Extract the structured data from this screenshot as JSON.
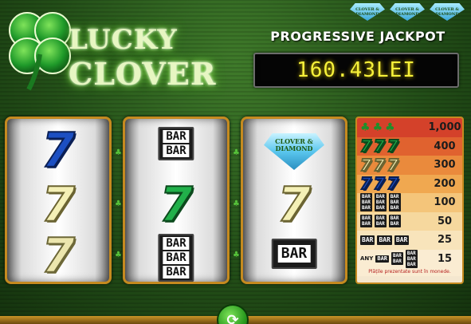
{
  "logo": {
    "line1": "LUCKY",
    "line2": "CLOVER",
    "icon": "four-leaf-clover-icon"
  },
  "top_badges": [
    {
      "text": "CLOVER & DIAMOND"
    },
    {
      "text": "CLOVER & DIAMOND"
    },
    {
      "text": "CLOVER & DIAMOND"
    }
  ],
  "jackpot": {
    "title": "PROGRESSIVE JACKPOT",
    "value": "160.43LEI"
  },
  "reels": [
    {
      "symbols": [
        "7",
        "7",
        "7"
      ],
      "colors": [
        "blue",
        "yellow",
        "pale"
      ]
    },
    {
      "symbols": [
        "BAR BAR",
        "7",
        "BAR BAR BAR"
      ],
      "colors": [
        "",
        "green",
        ""
      ]
    },
    {
      "symbols": [
        "CLOVER & DIAMOND",
        "7",
        "BAR"
      ],
      "colors": [
        "",
        "yellow",
        ""
      ]
    }
  ],
  "paytable": {
    "rows": [
      {
        "icons": "clover x3",
        "value": "1,000"
      },
      {
        "icons": "green 7 x3",
        "value": "400"
      },
      {
        "icons": "yellow 7 x3",
        "value": "300"
      },
      {
        "icons": "blue 7 x3",
        "value": "200"
      },
      {
        "icons": "BAR BAR BAR x3",
        "value": "100"
      },
      {
        "icons": "BAR BAR x3",
        "value": "50"
      },
      {
        "icons": "BAR x3",
        "value": "25"
      },
      {
        "icons": "ANY bars",
        "value": "15"
      }
    ],
    "any_label": "ANY",
    "note": "Plățile prezentate sunt în monede."
  },
  "spin": {
    "icon": "spin-arrows-icon"
  },
  "colors": {
    "background": "#234f18",
    "reel_frame": "#c58a1f",
    "jackpot_text": "#f5f03a",
    "paytable_header": "#d4412a",
    "paytable_light": "#f4e7cf"
  }
}
